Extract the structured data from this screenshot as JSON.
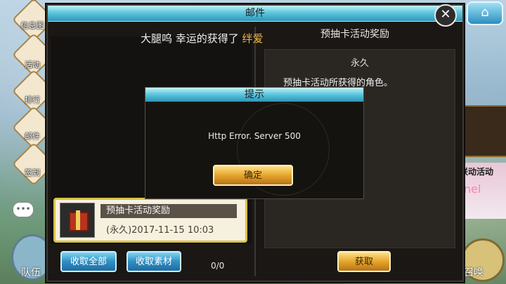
{
  "mail_dialog": {
    "title": "邮件",
    "close_icon": "close-icon"
  },
  "announcement": {
    "prefix": "大腿呜  幸运的获得了 ",
    "highlight": "绊爱"
  },
  "detail": {
    "header": "预抽卡活动奖励",
    "permanence": "永久",
    "description": "预抽卡活动所获得的角色。",
    "claim_label": "获取"
  },
  "mail_list": [
    {
      "title": "预抽卡活动奖励",
      "date": "(永久)2017-11-15  10:03",
      "icon": "gift-icon"
    }
  ],
  "actions": {
    "collect_all": "收取全部",
    "collect_materials": "收取素材",
    "count": "0/0"
  },
  "popup": {
    "title": "提示",
    "message": "Http Error. Server 500",
    "confirm": "确定"
  },
  "sidebar": [
    {
      "label": "信息图",
      "icon": "info-icon"
    },
    {
      "label": "活动",
      "icon": "event-icon"
    },
    {
      "label": "排行",
      "icon": "ranking-icon"
    },
    {
      "label": "邮件",
      "icon": "mail-icon"
    },
    {
      "label": "签到",
      "icon": "checkin-icon"
    }
  ],
  "bottom": {
    "team": "队伍",
    "summon": "召唤",
    "side_tag": "联动活动",
    "side_tag2": "nel"
  }
}
